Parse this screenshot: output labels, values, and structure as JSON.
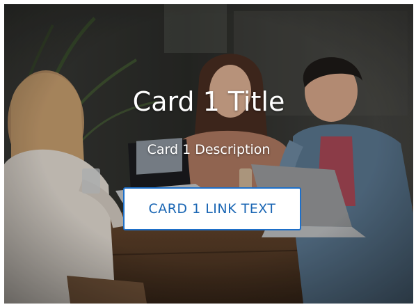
{
  "card": {
    "title": "Card 1 Title",
    "description": "Card 1 Description",
    "link_text": "CARD 1 LINK TEXT"
  },
  "colors": {
    "link_text": "#1a66b4",
    "link_border": "#1e6fc8",
    "link_background": "#ffffff",
    "title_text": "#ffffff"
  }
}
